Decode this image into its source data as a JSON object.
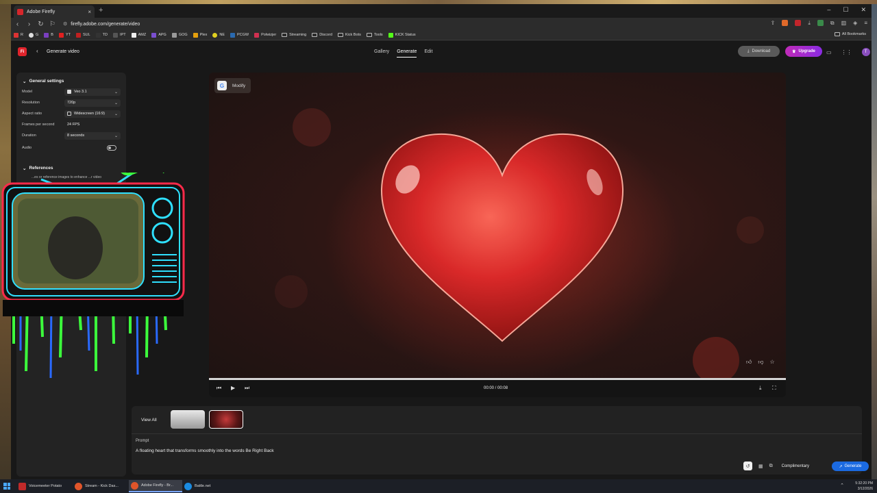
{
  "browser": {
    "tab_title": "Adobe Firefly",
    "url": "firefly.adobe.com/generate/video",
    "bookmarks": [
      "R",
      "G",
      "B",
      "YT",
      "SUL",
      "TD",
      "IPT",
      "AMZ",
      "APG",
      "GOG",
      "Plex",
      "NE",
      "PCGW",
      "Polwizjer",
      "Streaming",
      "Discord",
      "Kick Bots",
      "Tools",
      "KICK Status"
    ],
    "all_bookmarks": "All Bookmarks"
  },
  "app": {
    "logo": "Fi",
    "title": "Generate video",
    "nav": [
      "Gallery",
      "Generate",
      "Edit"
    ],
    "active_nav": "Generate",
    "download_label": "Download",
    "upgrade_label": "Upgrade",
    "avatar_initial": "T"
  },
  "settings": {
    "section_title": "General settings",
    "rows": [
      {
        "label": "Model",
        "value": "Veo 3.1"
      },
      {
        "label": "Resolution",
        "value": "720p"
      },
      {
        "label": "Aspect ratio",
        "value": "Widescreen (16:9)"
      },
      {
        "label": "Frames per second",
        "value": "24 FPS"
      },
      {
        "label": "Duration",
        "value": "8 seconds"
      }
    ],
    "audio_label": "Audio",
    "references_title": "References",
    "references_sub": "...es or reference images to enhance ...r video"
  },
  "player": {
    "modify_label": "Modify",
    "time": "00:00 / 00:08",
    "progress": 0.0
  },
  "bottom": {
    "view_all": "View All",
    "prompt_label": "Prompt",
    "prompt_text": "A floating heart that transforms smoothly into the words Be Right Back",
    "complimentary": "Complimentary",
    "generate_label": "Generate"
  },
  "taskbar": {
    "items": [
      "Voicemeeter Potato",
      "Stream - Kick Das...",
      "Adobe Firefly - Br...",
      "Battle.net"
    ],
    "time": "5:32:20 PM",
    "date": "3/12/2026"
  },
  "colors": {
    "accent_red": "#e0242c",
    "upgrade_purple": "#c02bb8",
    "generate_blue": "#1b6ae0"
  }
}
